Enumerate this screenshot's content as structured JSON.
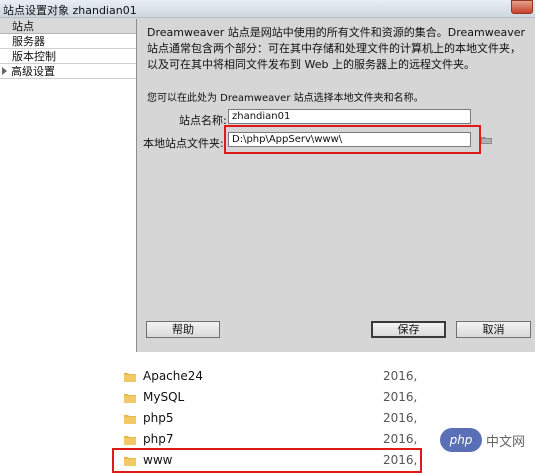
{
  "window": {
    "title": "站点设置对象 zhandian01"
  },
  "sidebar": {
    "items": [
      {
        "label": "站点"
      },
      {
        "label": "服务器"
      },
      {
        "label": "版本控制"
      },
      {
        "label": "高级设置"
      }
    ]
  },
  "content": {
    "description": "Dreamweaver 站点是网站中使用的所有文件和资源的集合。Dreamweaver 站点通常包含两个部分：可在其中存储和处理文件的计算机上的本地文件夹，以及可在其中将相同文件发布到 Web 上的服务器上的远程文件夹。",
    "hint": "您可以在此处为 Dreamweaver 站点选择本地文件夹和名称。",
    "site_name_label": "站点名称:",
    "site_name_value": "zhandian01",
    "local_folder_label": "本地站点文件夹:",
    "local_folder_value": "D:\\php\\AppServ\\www\\"
  },
  "buttons": {
    "help": "帮助",
    "save": "保存",
    "cancel": "取消"
  },
  "filelist": {
    "rows": [
      {
        "name": "Apache24",
        "date": "2016,"
      },
      {
        "name": "MySQL",
        "date": "2016,"
      },
      {
        "name": "php5",
        "date": "2016,"
      },
      {
        "name": "php7",
        "date": "2016,"
      },
      {
        "name": "www",
        "date": "2016,"
      }
    ]
  },
  "watermark": {
    "badge": "php",
    "text": "中文网"
  },
  "colors": {
    "highlight": "#e01919",
    "folder": "#e8b94a"
  }
}
